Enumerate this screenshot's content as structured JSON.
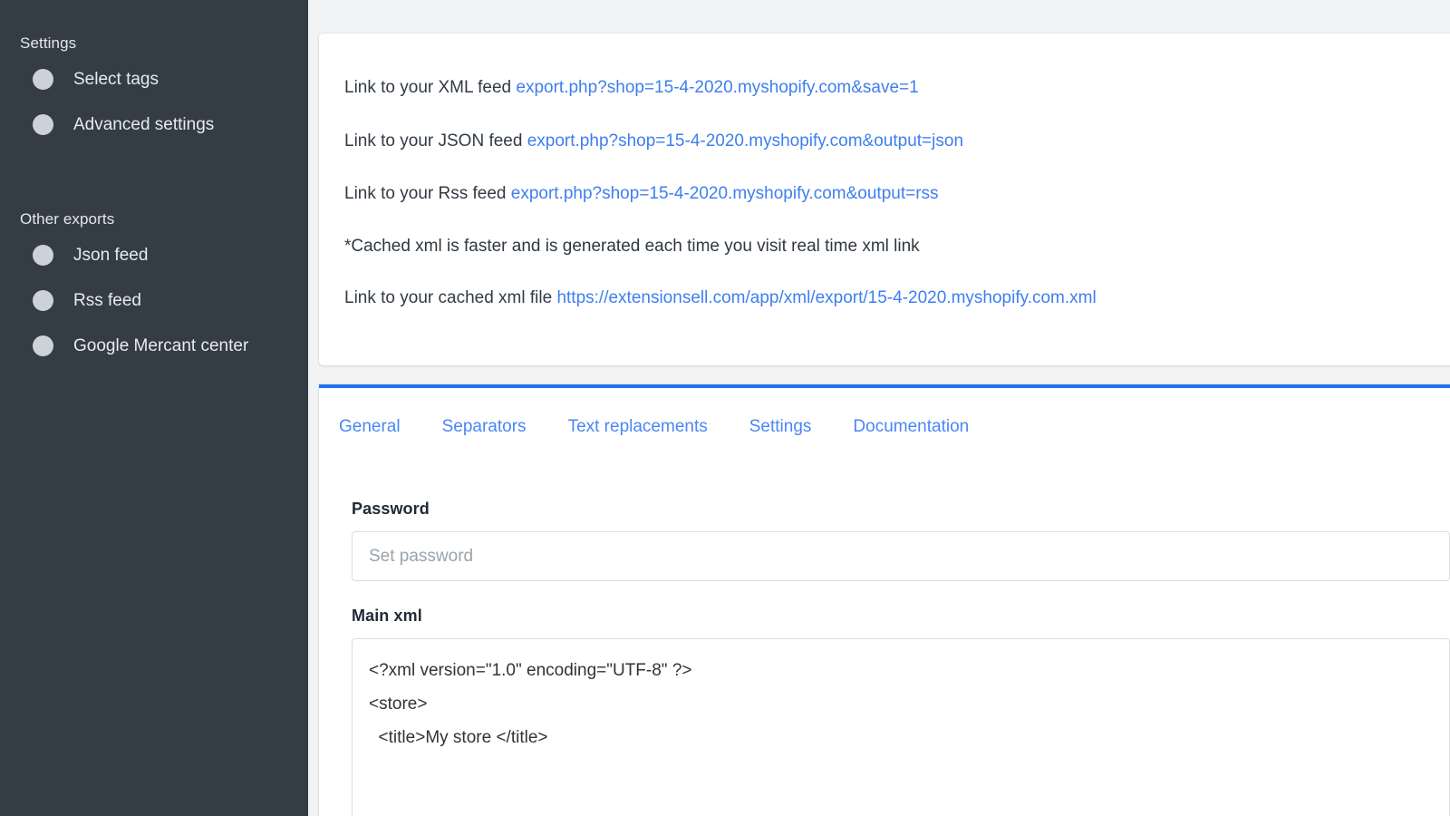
{
  "sidebar": {
    "groups": [
      {
        "title": "Settings",
        "items": [
          {
            "label": "Select tags"
          },
          {
            "label": "Advanced settings"
          }
        ]
      },
      {
        "title": "Other exports",
        "items": [
          {
            "label": "Json feed"
          },
          {
            "label": "Rss feed"
          },
          {
            "label": "Google Mercant center"
          }
        ]
      }
    ],
    "bullet_color": "#ccd2d8",
    "background_color": "#343c45"
  },
  "feeds_card": {
    "rows": [
      {
        "label": "Link to your XML feed ",
        "link": "export.php?shop=15-4-2020.myshopify.com&save=1"
      },
      {
        "label": "Link to your JSON feed ",
        "link": "export.php?shop=15-4-2020.myshopify.com&output=json"
      },
      {
        "label": "Link to your Rss feed ",
        "link": "export.php?shop=15-4-2020.myshopify.com&output=rss"
      }
    ],
    "note": "*Cached xml is faster and is generated each time you visit real time xml link",
    "cached": {
      "label": "Link to your cached xml file ",
      "link": "https://extensionsell.com/app/xml/export/15-4-2020.myshopify.com.xml"
    },
    "link_color": "#3d7ff0"
  },
  "settings_card": {
    "accent_color": "#1f72f2",
    "tabs": [
      {
        "label": "General"
      },
      {
        "label": "Separators"
      },
      {
        "label": "Text replacements"
      },
      {
        "label": "Settings"
      },
      {
        "label": "Documentation"
      }
    ],
    "fields": {
      "password": {
        "label": "Password",
        "value": "",
        "placeholder": "Set password"
      },
      "main_xml": {
        "label": "Main xml",
        "value": "<?xml version=\"1.0\" encoding=\"UTF-8\" ?>\n<store>\n  <title>My store </title>"
      }
    }
  }
}
